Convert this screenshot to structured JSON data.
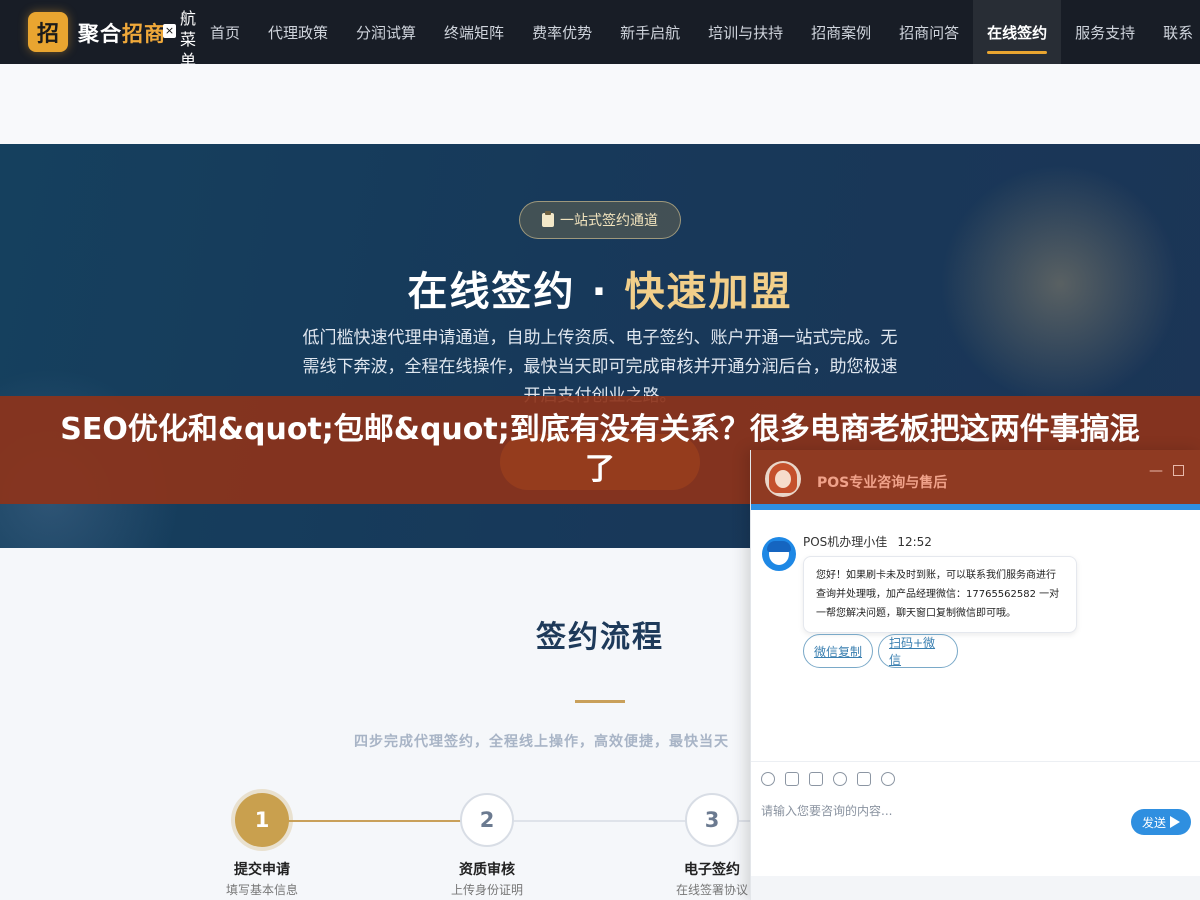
{
  "nav": {
    "logo_char": "招",
    "logo_text_main": "聚合",
    "logo_text_accent": "招商",
    "close_glyph": "×",
    "vertical_menu": [
      "航",
      "菜",
      "单"
    ],
    "items": [
      {
        "label": "首页"
      },
      {
        "label": "代理政策"
      },
      {
        "label": "分润试算"
      },
      {
        "label": "终端矩阵"
      },
      {
        "label": "费率优势"
      },
      {
        "label": "新手启航"
      },
      {
        "label": "培训与扶持"
      },
      {
        "label": "招商案例"
      },
      {
        "label": "招商问答"
      },
      {
        "label": "在线签约",
        "active": true
      },
      {
        "label": "服务支持"
      },
      {
        "label": "联系"
      }
    ]
  },
  "hero": {
    "pill": "一站式签约通道",
    "title_main": "在线签约 · ",
    "title_accent": "快速加盟",
    "desc": "低门槛快速代理申请通道，自助上传资质、电子签约、账户开通一站式完成。无需线下奔波，全程在线操作，最快当天即可完成审核并开通分润后台，助您极速开启支付创业之路。"
  },
  "seo_title": "SEO优化和&quot;包邮&quot;到底有没有关系？很多电商老板把这两件事搞混了",
  "process": {
    "title": "签约流程",
    "subtitle": "四步完成代理签约，全程线上操作，高效便捷，最快当天",
    "steps": [
      {
        "num": "1",
        "label": "提交申请",
        "sub": "填写基本信息",
        "done": true
      },
      {
        "num": "2",
        "label": "资质审核",
        "sub": "上传身份证明",
        "done": false
      },
      {
        "num": "3",
        "label": "电子签约",
        "sub": "在线签署协议",
        "done": false
      }
    ]
  },
  "chat": {
    "title": "POS专业咨询与售后",
    "min_glyph": "—",
    "agent_name": "POS机办理小佳",
    "time": "12:52",
    "message": "您好！如果刷卡未及时到账，可以联系我们服务商进行查询并处理哦，加产品经理微信：17765562582 一对一帮您解决问题，聊天窗口复制微信即可哦。",
    "buttons": [
      "微信复制",
      "扫码+微信"
    ],
    "tools": [
      "emoji-icon",
      "image-icon",
      "screenshot-icon",
      "rating-icon",
      "voice-icon",
      "wechat-icon"
    ],
    "input_placeholder": "请输入您要咨询的内容...",
    "send_label": "发送"
  },
  "colors": {
    "nav_bg": "#181d26",
    "accent_gold": "#e9a530",
    "hero_bg": "#17395a",
    "seo_banner": "#8d331a",
    "chat_header": "#8f3a22",
    "chat_blue": "#2f8fe0"
  }
}
